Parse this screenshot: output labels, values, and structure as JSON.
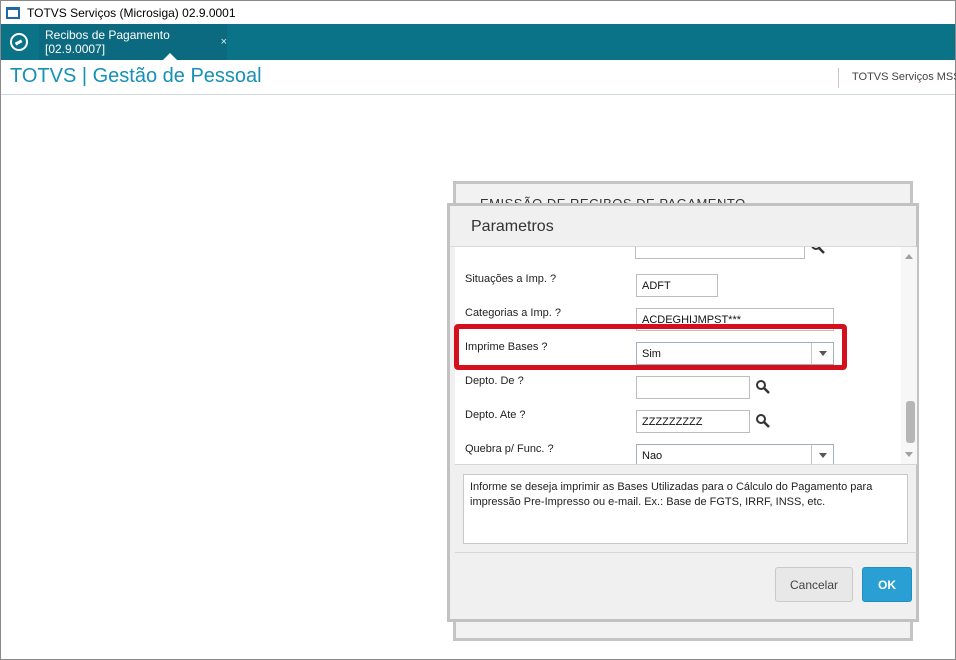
{
  "window": {
    "title": "TOTVS Serviços (Microsiga) 02.9.0001"
  },
  "tabbar": {
    "tabs": [
      {
        "label": "Recibos de Pagamento [02.9.0007]",
        "close": "×"
      }
    ]
  },
  "module": {
    "title": "TOTVS | Gestão de Pessoal",
    "company": "TOTVS Serviços MSS"
  },
  "background_panel": {
    "title": "EMISSÃO DE RECIBOS DE PAGAMENTO"
  },
  "dialog": {
    "title": "Parametros",
    "params": [
      {
        "label": "",
        "value": ""
      },
      {
        "label": "Situações a Imp. ?",
        "value": "ADFT"
      },
      {
        "label": "Categorias a Imp. ?",
        "value": "ACDEGHIJMPST***"
      },
      {
        "label": "Imprime Bases ?",
        "value": "Sim"
      },
      {
        "label": "Depto. De ?",
        "value": ""
      },
      {
        "label": "Depto. Ate ?",
        "value": "ZZZZZZZZZ"
      },
      {
        "label": "Quebra p/ Func. ?",
        "value": "Nao"
      }
    ],
    "help_text": "Informe se deseja imprimir as Bases Utilizadas para o Cálculo do Pagamento para impressão Pre-Impresso ou e-mail. Ex.:  Base de FGTS, IRRF, INSS, etc.",
    "buttons": {
      "cancel": "Cancelar",
      "ok": "OK"
    }
  },
  "colors": {
    "tabbar": "#0a7388",
    "module_title": "#1690b5",
    "highlight": "#d50f1c",
    "ok_button": "#2a9fd3"
  }
}
